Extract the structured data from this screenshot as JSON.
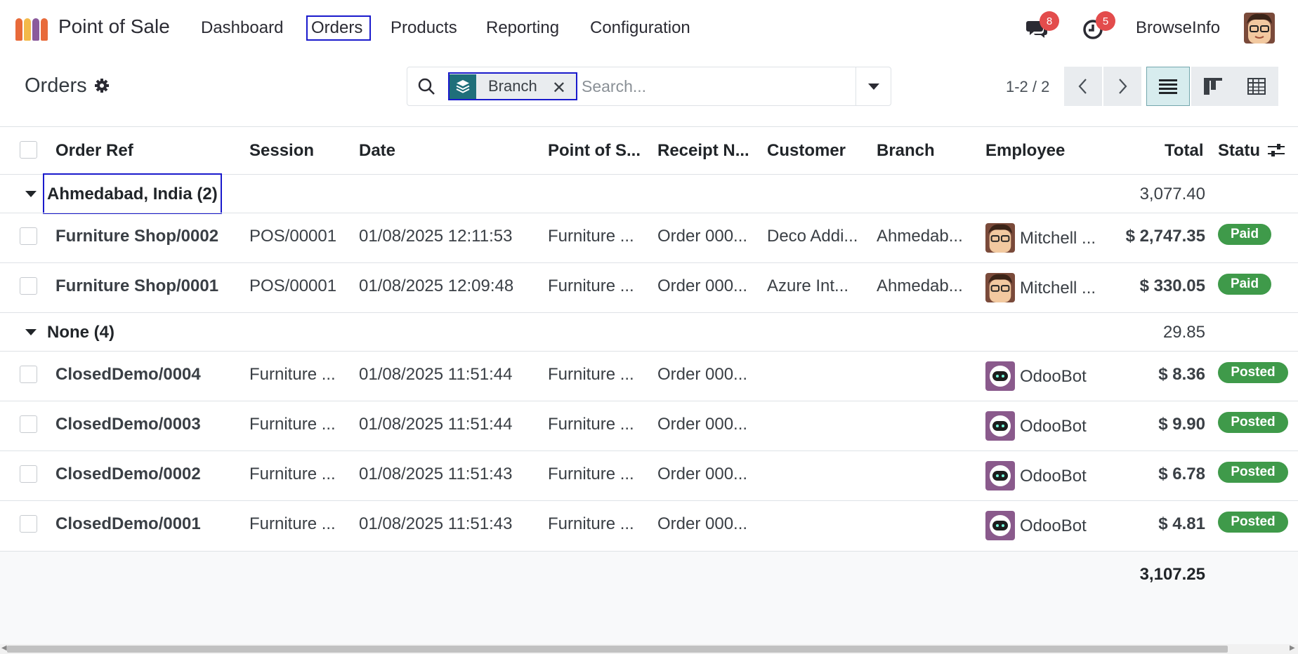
{
  "app": {
    "name": "Point of Sale"
  },
  "nav": {
    "items": [
      "Dashboard",
      "Orders",
      "Products",
      "Reporting",
      "Configuration"
    ]
  },
  "topbar": {
    "messages_count": "8",
    "activities_count": "5",
    "company": "BrowseInfo"
  },
  "control": {
    "title": "Orders",
    "facet_label": "Branch",
    "search_placeholder": "Search...",
    "pager": "1-2 / 2"
  },
  "table": {
    "headers": [
      "Order Ref",
      "Session",
      "Date",
      "Point of S...",
      "Receipt N...",
      "Customer",
      "Branch",
      "Employee",
      "Total",
      "Statu"
    ],
    "groups": [
      {
        "label": "Ahmedabad, India (2)",
        "total": "3,077.40",
        "rows": [
          {
            "ref": "Furniture Shop/0002",
            "session": "POS/00001",
            "date": "01/08/2025 12:11:53",
            "pos": "Furniture ...",
            "receipt": "Order 000...",
            "customer": "Deco Addi...",
            "branch": "Ahmedab...",
            "employee": "Mitchell ...",
            "total": "$ 2,747.35",
            "status": "Paid"
          },
          {
            "ref": "Furniture Shop/0001",
            "session": "POS/00001",
            "date": "01/08/2025 12:09:48",
            "pos": "Furniture ...",
            "receipt": "Order 000...",
            "customer": "Azure Int...",
            "branch": "Ahmedab...",
            "employee": "Mitchell ...",
            "total": "$ 330.05",
            "status": "Paid"
          }
        ]
      },
      {
        "label": "None (4)",
        "total": "29.85",
        "rows": [
          {
            "ref": "ClosedDemo/0004",
            "session": "Furniture ...",
            "date": "01/08/2025 11:51:44",
            "pos": "Furniture ...",
            "receipt": "Order 000...",
            "customer": "",
            "branch": "",
            "employee": "OdooBot",
            "total": "$ 8.36",
            "status": "Posted"
          },
          {
            "ref": "ClosedDemo/0003",
            "session": "Furniture ...",
            "date": "01/08/2025 11:51:44",
            "pos": "Furniture ...",
            "receipt": "Order 000...",
            "customer": "",
            "branch": "",
            "employee": "OdooBot",
            "total": "$ 9.90",
            "status": "Posted"
          },
          {
            "ref": "ClosedDemo/0002",
            "session": "Furniture ...",
            "date": "01/08/2025 11:51:43",
            "pos": "Furniture ...",
            "receipt": "Order 000...",
            "customer": "",
            "branch": "",
            "employee": "OdooBot",
            "total": "$ 6.78",
            "status": "Posted"
          },
          {
            "ref": "ClosedDemo/0001",
            "session": "Furniture ...",
            "date": "01/08/2025 11:51:43",
            "pos": "Furniture ...",
            "receipt": "Order 000...",
            "customer": "",
            "branch": "",
            "employee": "OdooBot",
            "total": "$ 4.81",
            "status": "Posted"
          }
        ]
      }
    ],
    "grand_total": "3,107.25"
  },
  "colors": {
    "accent": "#1f6f7a",
    "status_green": "#3f9a4a",
    "badge_red": "#e34c4c",
    "highlight_box": "#1a1acc"
  },
  "icons": [
    "app-logo-icon",
    "chat-icon",
    "clock-icon",
    "gear-icon",
    "search-icon",
    "layers-icon",
    "close-icon",
    "caret-down-icon",
    "chevron-left-icon",
    "chevron-right-icon",
    "list-view-icon",
    "kanban-view-icon",
    "pivot-view-icon",
    "optional-columns-icon"
  ]
}
